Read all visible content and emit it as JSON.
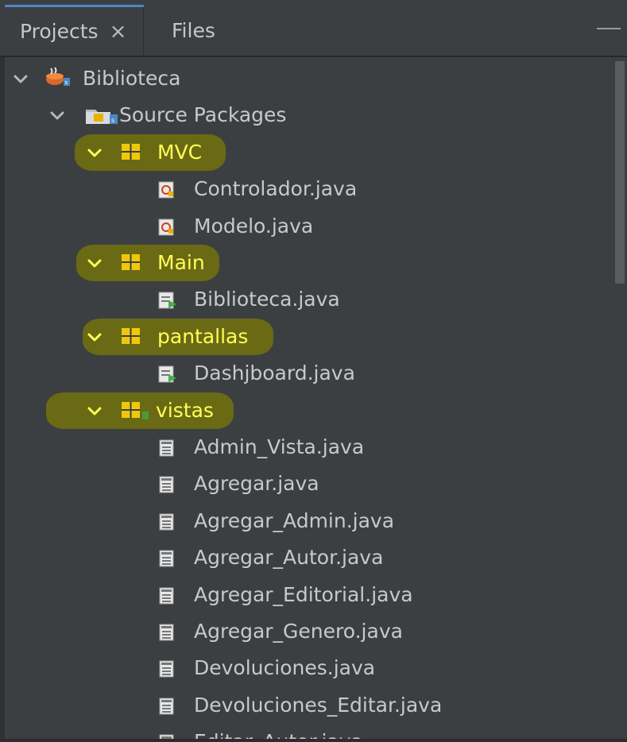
{
  "tabs": [
    {
      "label": "Projects",
      "active": true,
      "close": "×"
    },
    {
      "label": "Files",
      "active": false
    }
  ],
  "colors": {
    "background": "#3c3f41",
    "text": "#c7c9cb",
    "package_text": "#ffff55",
    "highlight": "#6d6d12",
    "package_icon": "#f0c80a"
  },
  "tree": {
    "project": {
      "label": "Biblioteca",
      "icon": "java-project-icon",
      "expanded": true
    },
    "source_packages": {
      "label": "Source Packages",
      "icon": "source-folder-icon",
      "expanded": true
    },
    "packages": [
      {
        "label": "MVC",
        "expanded": true,
        "highlighted": true,
        "files": [
          {
            "label": "Controlador.java",
            "icon": "java-class-icon"
          },
          {
            "label": "Modelo.java",
            "icon": "java-class-icon"
          }
        ]
      },
      {
        "label": "Main",
        "expanded": true,
        "highlighted": true,
        "files": [
          {
            "label": "Biblioteca.java",
            "icon": "java-main-class-icon"
          }
        ]
      },
      {
        "label": "pantallas",
        "expanded": true,
        "highlighted": true,
        "files": [
          {
            "label": "Dashjboard.java",
            "icon": "java-main-class-icon"
          }
        ]
      },
      {
        "label": "vistas",
        "expanded": true,
        "highlighted": true,
        "files": [
          {
            "label": "Admin_Vista.java",
            "icon": "form-icon"
          },
          {
            "label": "Agregar.java",
            "icon": "form-icon"
          },
          {
            "label": "Agregar_Admin.java",
            "icon": "form-icon"
          },
          {
            "label": "Agregar_Autor.java",
            "icon": "form-icon"
          },
          {
            "label": "Agregar_Editorial.java",
            "icon": "form-icon"
          },
          {
            "label": "Agregar_Genero.java",
            "icon": "form-icon"
          },
          {
            "label": "Devoluciones.java",
            "icon": "form-icon"
          },
          {
            "label": "Devoluciones_Editar.java",
            "icon": "form-icon"
          },
          {
            "label": "Editar_Autor.java",
            "icon": "form-icon"
          }
        ]
      }
    ]
  }
}
